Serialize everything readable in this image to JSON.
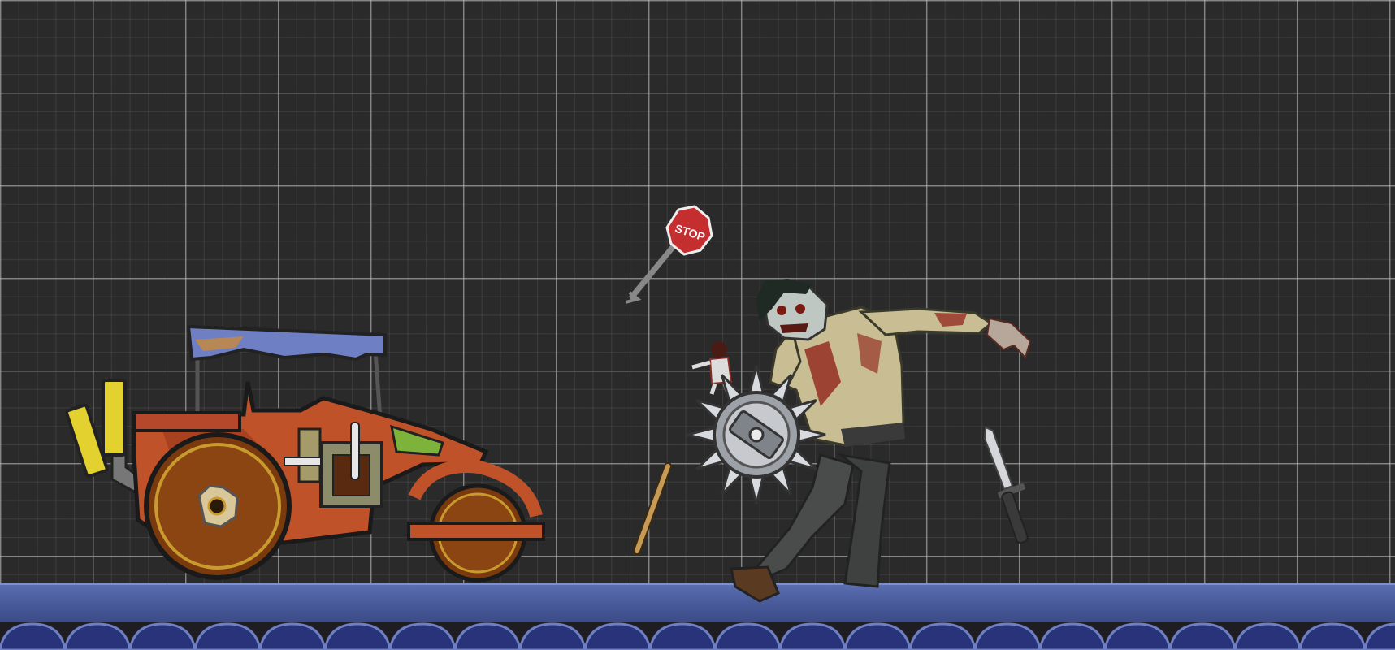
{
  "scene": {
    "name": "zombie-ragdoll-sandbox",
    "background_color": "#2a2a2a",
    "grid_color": "#bdbdbd"
  },
  "props": {
    "road_roller": {
      "body_color": "#c0522a",
      "wheel_color": "#7a3a0e",
      "canopy_color": "#6f7fc4",
      "exhaust_color": "#e3d12f"
    },
    "stop_sign": {
      "text": "STOP",
      "color": "#c42e2e"
    },
    "saw_blade": {
      "color": "#b9bcc2"
    },
    "wooden_stick": {
      "color": "#c79a55"
    },
    "knife": {
      "blade_color": "#d5d7da",
      "handle_color": "#3a3a3a"
    },
    "small_ragdoll": {
      "shirt_color": "#dcdcdc"
    }
  },
  "zombie": {
    "skin_color": "#bfc7c3",
    "shirt_color": "#c9bd93",
    "pants_color": "#4a4c4c",
    "blood_color": "#8e1b14"
  },
  "ground": {
    "bar_color": "#4f62a6",
    "pattern_color": "#28337a"
  }
}
